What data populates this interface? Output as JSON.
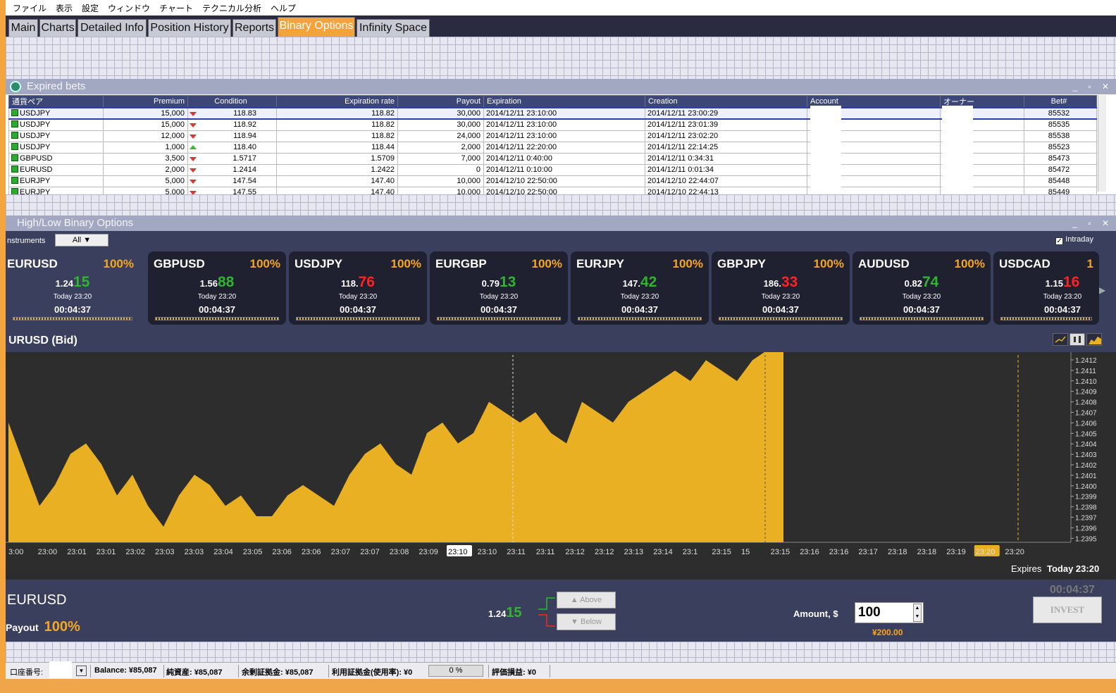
{
  "menu": [
    "ファイル",
    "表示",
    "設定",
    "ウィンドウ",
    "チャート",
    "テクニカル分析",
    "ヘルプ"
  ],
  "tabs": [
    "Main",
    "Charts",
    "Detailed Info",
    "Position History",
    "Reports",
    "Binary Options",
    "Infinity Space"
  ],
  "active_tab": "Binary Options",
  "expired_bets": {
    "title": "Expired bets",
    "columns": [
      "通貨ペア",
      "Premium",
      "Condition",
      "Expiration rate",
      "Payout",
      "Expiration",
      "Creation",
      "Account",
      "オーナー",
      "Bet#"
    ],
    "rows": [
      {
        "pair": "USDJPY",
        "premium": "15,000",
        "dir": "down",
        "condition": "118.83",
        "exp_rate": "118.82",
        "payout": "30,000",
        "expiration": "2014/12/11 23:10:00",
        "creation": "2014/12/11 23:00:29",
        "bet": "85532"
      },
      {
        "pair": "USDJPY",
        "premium": "15,000",
        "dir": "down",
        "condition": "118.92",
        "exp_rate": "118.82",
        "payout": "30,000",
        "expiration": "2014/12/11 23:10:00",
        "creation": "2014/12/11 23:01:39",
        "bet": "85535"
      },
      {
        "pair": "USDJPY",
        "premium": "12,000",
        "dir": "down",
        "condition": "118.94",
        "exp_rate": "118.82",
        "payout": "24,000",
        "expiration": "2014/12/11 23:10:00",
        "creation": "2014/12/11 23:02:20",
        "bet": "85538"
      },
      {
        "pair": "USDJPY",
        "premium": "1,000",
        "dir": "up",
        "condition": "118.40",
        "exp_rate": "118.44",
        "payout": "2,000",
        "expiration": "2014/12/11 22:20:00",
        "creation": "2014/12/11 22:14:25",
        "bet": "85523"
      },
      {
        "pair": "GBPUSD",
        "premium": "3,500",
        "dir": "down",
        "condition": "1.5717",
        "exp_rate": "1.5709",
        "payout": "7,000",
        "expiration": "2014/12/11 0:40:00",
        "creation": "2014/12/11 0:34:31",
        "bet": "85473"
      },
      {
        "pair": "EURUSD",
        "premium": "2,000",
        "dir": "down",
        "condition": "1.2414",
        "exp_rate": "1.2422",
        "payout": "0",
        "expiration": "2014/12/11 0:10:00",
        "creation": "2014/12/11 0:01:34",
        "bet": "85472"
      },
      {
        "pair": "EURJPY",
        "premium": "5,000",
        "dir": "down",
        "condition": "147.54",
        "exp_rate": "147.40",
        "payout": "10,000",
        "expiration": "2014/12/10 22:50:00",
        "creation": "2014/12/10 22:44:07",
        "bet": "85448"
      },
      {
        "pair": "EURJPY",
        "premium": "5,000",
        "dir": "down",
        "condition": "147.55",
        "exp_rate": "147.40",
        "payout": "10,000",
        "expiration": "2014/12/10 22:50:00",
        "creation": "2014/12/10 22:44:13",
        "bet": "85449"
      }
    ]
  },
  "hl": {
    "title": "High/Low Binary Options",
    "instruments_label": "nstruments",
    "filter": "All",
    "intraday": "Intraday"
  },
  "cards": [
    {
      "sym": "EURUSD",
      "pay": "100%",
      "base": "1.24",
      "big": "15",
      "color": "green",
      "time": "Today 23:20",
      "cd": "00:04:37"
    },
    {
      "sym": "GBPUSD",
      "pay": "100%",
      "base": "1.56",
      "big": "88",
      "color": "green",
      "time": "Today 23:20",
      "cd": "00:04:37"
    },
    {
      "sym": "USDJPY",
      "pay": "100%",
      "base": "118.",
      "big": "76",
      "color": "red",
      "time": "Today 23:20",
      "cd": "00:04:37"
    },
    {
      "sym": "EURGBP",
      "pay": "100%",
      "base": "0.79",
      "big": "13",
      "color": "green",
      "time": "Today 23:20",
      "cd": "00:04:37"
    },
    {
      "sym": "EURJPY",
      "pay": "100%",
      "base": "147.",
      "big": "42",
      "color": "green",
      "time": "Today 23:20",
      "cd": "00:04:37"
    },
    {
      "sym": "GBPJPY",
      "pay": "100%",
      "base": "186.",
      "big": "33",
      "color": "red",
      "time": "Today 23:20",
      "cd": "00:04:37"
    },
    {
      "sym": "AUDUSD",
      "pay": "100%",
      "base": "0.82",
      "big": "74",
      "color": "green",
      "time": "Today 23:20",
      "cd": "00:04:37"
    },
    {
      "sym": "USDCAD",
      "pay": "1",
      "base": "1.15",
      "big": "16",
      "color": "red",
      "time": "Today 23:20",
      "cd": "00:04:37"
    }
  ],
  "chart": {
    "title": "URUSD (Bid)",
    "y_ticks": [
      "1.2412",
      "1.2411",
      "1.2410",
      "1.2409",
      "1.2408",
      "1.2407",
      "1.2406",
      "1.2405",
      "1.2404",
      "1.2403",
      "1.2402",
      "1.2401",
      "1.2400",
      "1.2399",
      "1.2398",
      "1.2397",
      "1.2396",
      "1.2395"
    ],
    "x_ticks": [
      "3:00",
      "23:00",
      "23:01",
      "23:01",
      "23:02",
      "23:03",
      "23:03",
      "23:04",
      "23:05",
      "23:06",
      "23:06",
      "23:07",
      "23:07",
      "23:08",
      "23:09",
      "23:10",
      "23:10",
      "23:11",
      "23:11",
      "23:12",
      "23:12",
      "23:13",
      "23:14",
      "23:1",
      "23:15",
      "15",
      "23:15",
      "23:16",
      "23:16",
      "23:17",
      "23:18",
      "23:18",
      "23:19",
      "23:20",
      "23:20"
    ],
    "expires_label": "Expires",
    "expires_value": "Today 23:20",
    "fill_color": "#e9b024"
  },
  "chart_data": {
    "type": "area",
    "title": "URUSD (Bid)",
    "xlabel": "",
    "ylabel": "",
    "ylim": [
      1.23945,
      1.24125
    ],
    "series": [
      {
        "values": [
          1.2406,
          1.2402,
          1.2398,
          1.24,
          1.2403,
          1.2404,
          1.2402,
          1.2399,
          1.2401,
          1.2398,
          1.2396,
          1.2399,
          1.2401,
          1.24,
          1.2398,
          1.2399,
          1.2397,
          1.2397,
          1.2399,
          1.24,
          1.2399,
          1.2398,
          1.2401,
          1.2403,
          1.2404,
          1.2402,
          1.2401,
          1.2405,
          1.2406,
          1.2404,
          1.2405,
          1.2408,
          1.2407,
          1.2406,
          1.2407,
          1.2405,
          1.2404,
          1.2408,
          1.2407,
          1.2406,
          1.2408,
          1.2409,
          1.241,
          1.2411,
          1.241,
          1.2412,
          1.2411,
          1.241,
          1.2412,
          1.2413,
          1.2413
        ]
      }
    ]
  },
  "bottom": {
    "countdown": "00:04:37",
    "pair": "EURUSD",
    "payout_label": "Payout",
    "payout_value": "100%",
    "rate_base": "1.24",
    "rate_big": "15",
    "above": "Above",
    "below": "Below",
    "amount_label": "Amount, $",
    "amount": "100",
    "yen": "¥200.00",
    "invest": "INVEST"
  },
  "status": {
    "account_label": "口座番号:",
    "balance": "Balance: ¥85,087",
    "net": "純資産: ¥85,087",
    "margin_free": "余剰証拠金: ¥85,087",
    "margin_used": "利用証拠金(使用率): ¥0",
    "pct": "0 %",
    "pl": "評価損益: ¥0"
  }
}
